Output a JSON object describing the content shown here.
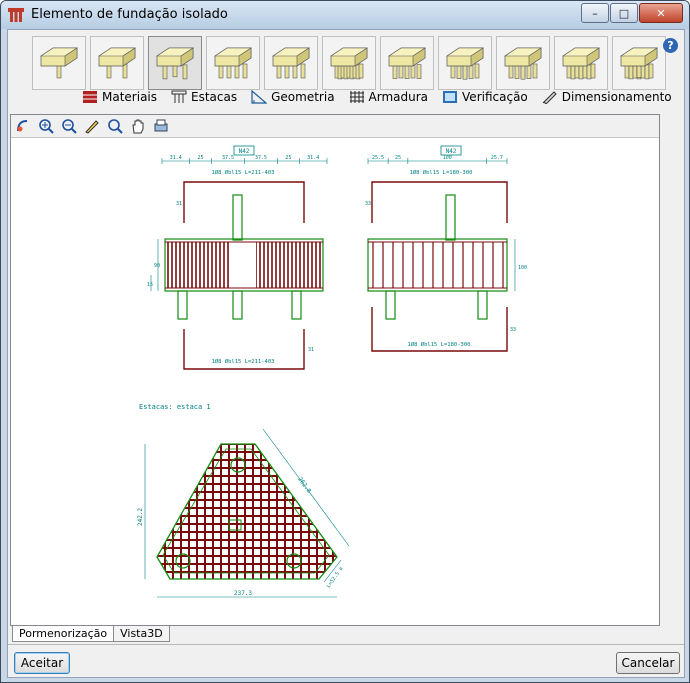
{
  "window": {
    "title": "Elemento de fundação isolado",
    "minimize": "–",
    "maximize": "□",
    "close": "✕"
  },
  "help": "?",
  "footing_types": [
    {
      "name": "footing-1-pile",
      "pins": 1,
      "selected": false
    },
    {
      "name": "footing-2-piles",
      "pins": 2,
      "selected": false
    },
    {
      "name": "footing-3-piles",
      "pins": 3,
      "selected": true
    },
    {
      "name": "footing-4-piles",
      "pins": 4,
      "selected": false
    },
    {
      "name": "footing-4-piles-b",
      "pins": 4,
      "selected": false
    },
    {
      "name": "footing-9-piles",
      "pins": 9,
      "selected": false
    },
    {
      "name": "footing-5-piles",
      "pins": 5,
      "selected": false
    },
    {
      "name": "footing-6-piles",
      "pins": 6,
      "selected": false
    },
    {
      "name": "footing-6-piles-b",
      "pins": 6,
      "selected": false
    },
    {
      "name": "footing-7-piles",
      "pins": 7,
      "selected": false
    },
    {
      "name": "footing-8-piles",
      "pins": 8,
      "selected": false
    }
  ],
  "menu": {
    "materiais": "Materiais",
    "estacas": "Estacas",
    "geometria": "Geometria",
    "armadura": "Armadura",
    "verificacao": "Verificação",
    "dimensionamento": "Dimensionamento"
  },
  "drawing": {
    "left_view_label": "N42",
    "right_view_label": "N42",
    "left_dims": [
      "31.4",
      "25",
      "37.5",
      "37.5",
      "25",
      "31.4"
    ],
    "right_dims": [
      "25.5",
      "25",
      "100",
      "25.7"
    ],
    "left_bar_top": "1Ø8 Øbl15   L=211-403",
    "left_bar_bottom": "1Ø8 Øbl15   L=211-403",
    "right_bar_top": "1Ø8 Øbl15   L=180-300",
    "right_bar_bottom": "1Ø8 Øbl15   L=180-300",
    "left_side_dims": [
      "31",
      "90",
      "15"
    ],
    "right_side_dims": [
      "33",
      "100",
      "33"
    ],
    "bottom_side_dim": "31",
    "estacas_caption": "Estacas: estaca 1",
    "plan_height": "242.2",
    "plan_side": "262.8",
    "plan_base": "237.3",
    "plan_corner": "L=52.5 a"
  },
  "tabs": {
    "pormenorizacao": "Pormenorização",
    "vista3d": "Vista3D"
  },
  "buttons": {
    "ok": "Aceitar",
    "cancel": "Cancelar"
  }
}
